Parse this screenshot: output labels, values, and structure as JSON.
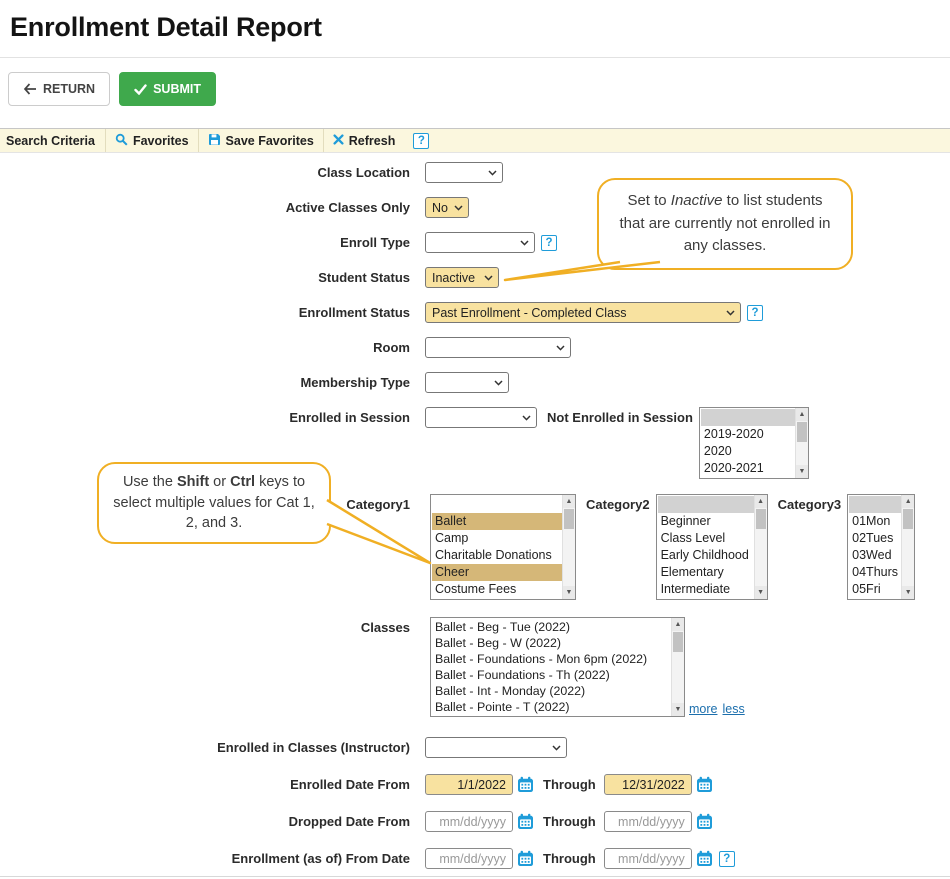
{
  "colors": {
    "accent_blue": "#1F9CD9",
    "link_blue": "#1C6FAD",
    "submit_green": "#3FA94C",
    "highlight_yellow": "#F8E2A0",
    "selected_tan": "#D5B778",
    "selected_gray": "#D2D2D2",
    "callout_orange": "#F0AF24"
  },
  "page_title": "Enrollment Detail Report",
  "toolbar": {
    "return_label": "RETURN",
    "submit_label": "SUBMIT"
  },
  "tabbar": {
    "search_criteria": "Search Criteria",
    "favorites": "Favorites",
    "save_favorites": "Save Favorites",
    "refresh": "Refresh",
    "help": "?"
  },
  "form": {
    "class_location": {
      "label": "Class Location",
      "value": ""
    },
    "active_classes_only": {
      "label": "Active Classes Only",
      "value": "No"
    },
    "enroll_type": {
      "label": "Enroll Type",
      "value": ""
    },
    "student_status": {
      "label": "Student Status",
      "value": "Inactive"
    },
    "enrollment_status": {
      "label": "Enrollment Status",
      "value": "Past Enrollment - Completed Class"
    },
    "room": {
      "label": "Room",
      "value": ""
    },
    "membership_type": {
      "label": "Membership Type",
      "value": ""
    },
    "enrolled_in_session": {
      "label": "Enrolled in Session",
      "value": ""
    },
    "not_enrolled_in_session": {
      "label": "Not Enrolled in Session",
      "options": [
        {
          "label": "",
          "selected": true
        },
        {
          "label": "2019-2020"
        },
        {
          "label": "2020"
        },
        {
          "label": "2020-2021"
        }
      ]
    },
    "category1": {
      "label": "Category1",
      "options": [
        {
          "label": ""
        },
        {
          "label": "Ballet",
          "selected": true
        },
        {
          "label": "Camp"
        },
        {
          "label": "Charitable Donations"
        },
        {
          "label": "Cheer",
          "selected": true
        },
        {
          "label": "Costume Fees"
        }
      ]
    },
    "category2": {
      "label": "Category2",
      "options": [
        {
          "label": "",
          "selected": true
        },
        {
          "label": "Beginner"
        },
        {
          "label": "Class Level"
        },
        {
          "label": "Early Childhood"
        },
        {
          "label": "Elementary"
        },
        {
          "label": "Intermediate"
        }
      ]
    },
    "category3": {
      "label": "Category3",
      "options": [
        {
          "label": "",
          "selected": true
        },
        {
          "label": "01Mon"
        },
        {
          "label": "02Tues"
        },
        {
          "label": "03Wed"
        },
        {
          "label": "04Thurs"
        },
        {
          "label": "05Fri"
        }
      ]
    },
    "classes": {
      "label": "Classes",
      "options": [
        {
          "label": "Ballet - Beg - Tue (2022)"
        },
        {
          "label": "Ballet - Beg - W (2022)"
        },
        {
          "label": "Ballet - Foundations - Mon 6pm (2022)"
        },
        {
          "label": "Ballet - Foundations - Th (2022)"
        },
        {
          "label": "Ballet - Int - Monday (2022)"
        },
        {
          "label": "Ballet - Pointe - T (2022)"
        }
      ],
      "more_link": "more",
      "less_link": "less"
    },
    "instructor": {
      "label": "Enrolled in Classes (Instructor)",
      "value": ""
    },
    "through_label": "Through",
    "date_placeholder": "mm/dd/yyyy",
    "enrolled_date": {
      "label": "Enrolled Date From",
      "from": "1/1/2022",
      "to": "12/31/2022"
    },
    "dropped_date": {
      "label": "Dropped Date From"
    },
    "enrollment_asof": {
      "label": "Enrollment (as of) From Date"
    }
  },
  "callouts": {
    "inactive": {
      "part1": "Set to ",
      "emphasis": "Inactive",
      "part2": " to list students that are currently not enrolled in any classes."
    },
    "multiselect": {
      "part1": "Use the ",
      "bold1": "Shift",
      "part2": " or ",
      "bold2": "Ctrl",
      "part3": " keys to select multiple values for Cat 1, 2, and 3."
    }
  }
}
